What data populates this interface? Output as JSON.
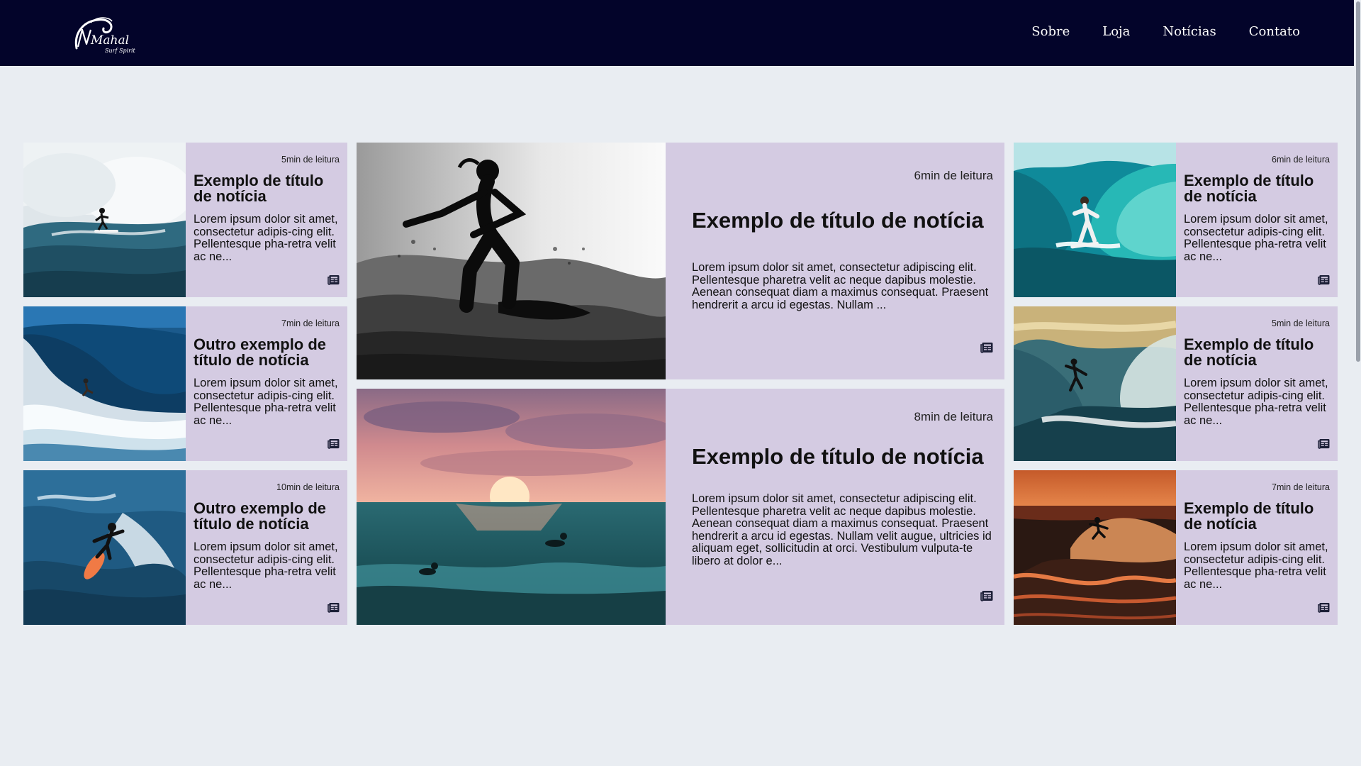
{
  "header": {
    "logo_text": "Mahal Surf Spirit",
    "nav": [
      "Sobre",
      "Loja",
      "Notícias",
      "Contato"
    ]
  },
  "colors": {
    "header_bg": "#03042a",
    "page_bg": "#e9edf2",
    "card_bg": "#d4cbe2",
    "icon": "#1d2038"
  },
  "icons": {
    "read_more": "newspaper-icon"
  },
  "cards": {
    "left": [
      {
        "read_time": "5min de leitura",
        "title": "Exemplo de título de notícia",
        "excerpt": "Lorem ipsum dolor sit amet, consectetur adipis-cing elit. Pellentesque pha-retra velit ac ne...",
        "image": "surfer-big-white-wave"
      },
      {
        "read_time": "7min de leitura",
        "title": "Outro exemplo de título de notícia",
        "excerpt": "Lorem ipsum dolor sit amet, consectetur adipis-cing elit. Pellentesque pha-retra velit ac ne...",
        "image": "surfer-blue-barrel"
      },
      {
        "read_time": "10min de leitura",
        "title": "Outro exemplo de título de notícia",
        "excerpt": "Lorem ipsum dolor sit amet, consectetur adipis-cing elit. Pellentesque pha-retra velit ac ne...",
        "image": "surfer-carving-orange-board"
      }
    ],
    "center": [
      {
        "read_time": "6min de leitura",
        "title": "Exemplo de título de notícia",
        "excerpt": "Lorem ipsum dolor sit amet, consectetur adipiscing elit. Pellentesque pharetra velit ac neque dapibus molestie. Aenean consequat diam a maximus consequat. Praesent hendrerit a arcu id egestas. Nullam ...",
        "image": "surfer-silhouette-bw"
      },
      {
        "read_time": "8min de leitura",
        "title": "Exemplo de título de notícia",
        "excerpt": "Lorem ipsum dolor sit amet, consectetur adipiscing elit. Pellentesque pharetra velit ac neque dapibus molestie. Aenean consequat diam a maximus consequat. Praesent hendrerit a arcu id egestas. Nullam velit augue, ultricies id aliquam eget, sollicitudin at orci. Vestibulum vulputa-te libero at dolor e...",
        "image": "sunset-ocean-surfers"
      }
    ],
    "right": [
      {
        "read_time": "6min de leitura",
        "title": "Exemplo de título de notícia",
        "excerpt": "Lorem ipsum dolor sit amet, consectetur adipis-cing elit. Pellentesque pha-retra velit ac ne...",
        "image": "surfer-turquoise-tube"
      },
      {
        "read_time": "5min de leitura",
        "title": "Exemplo de título de notícia",
        "excerpt": "Lorem ipsum dolor sit amet, consectetur adipis-cing elit. Pellentesque pha-retra velit ac ne...",
        "image": "surfer-golden-wave"
      },
      {
        "read_time": "7min de leitura",
        "title": "Exemplo de título de notícia",
        "excerpt": "Lorem ipsum dolor sit amet, consectetur adipis-cing elit. Pellentesque pha-retra velit ac ne...",
        "image": "surfer-sunset-spray"
      }
    ]
  }
}
